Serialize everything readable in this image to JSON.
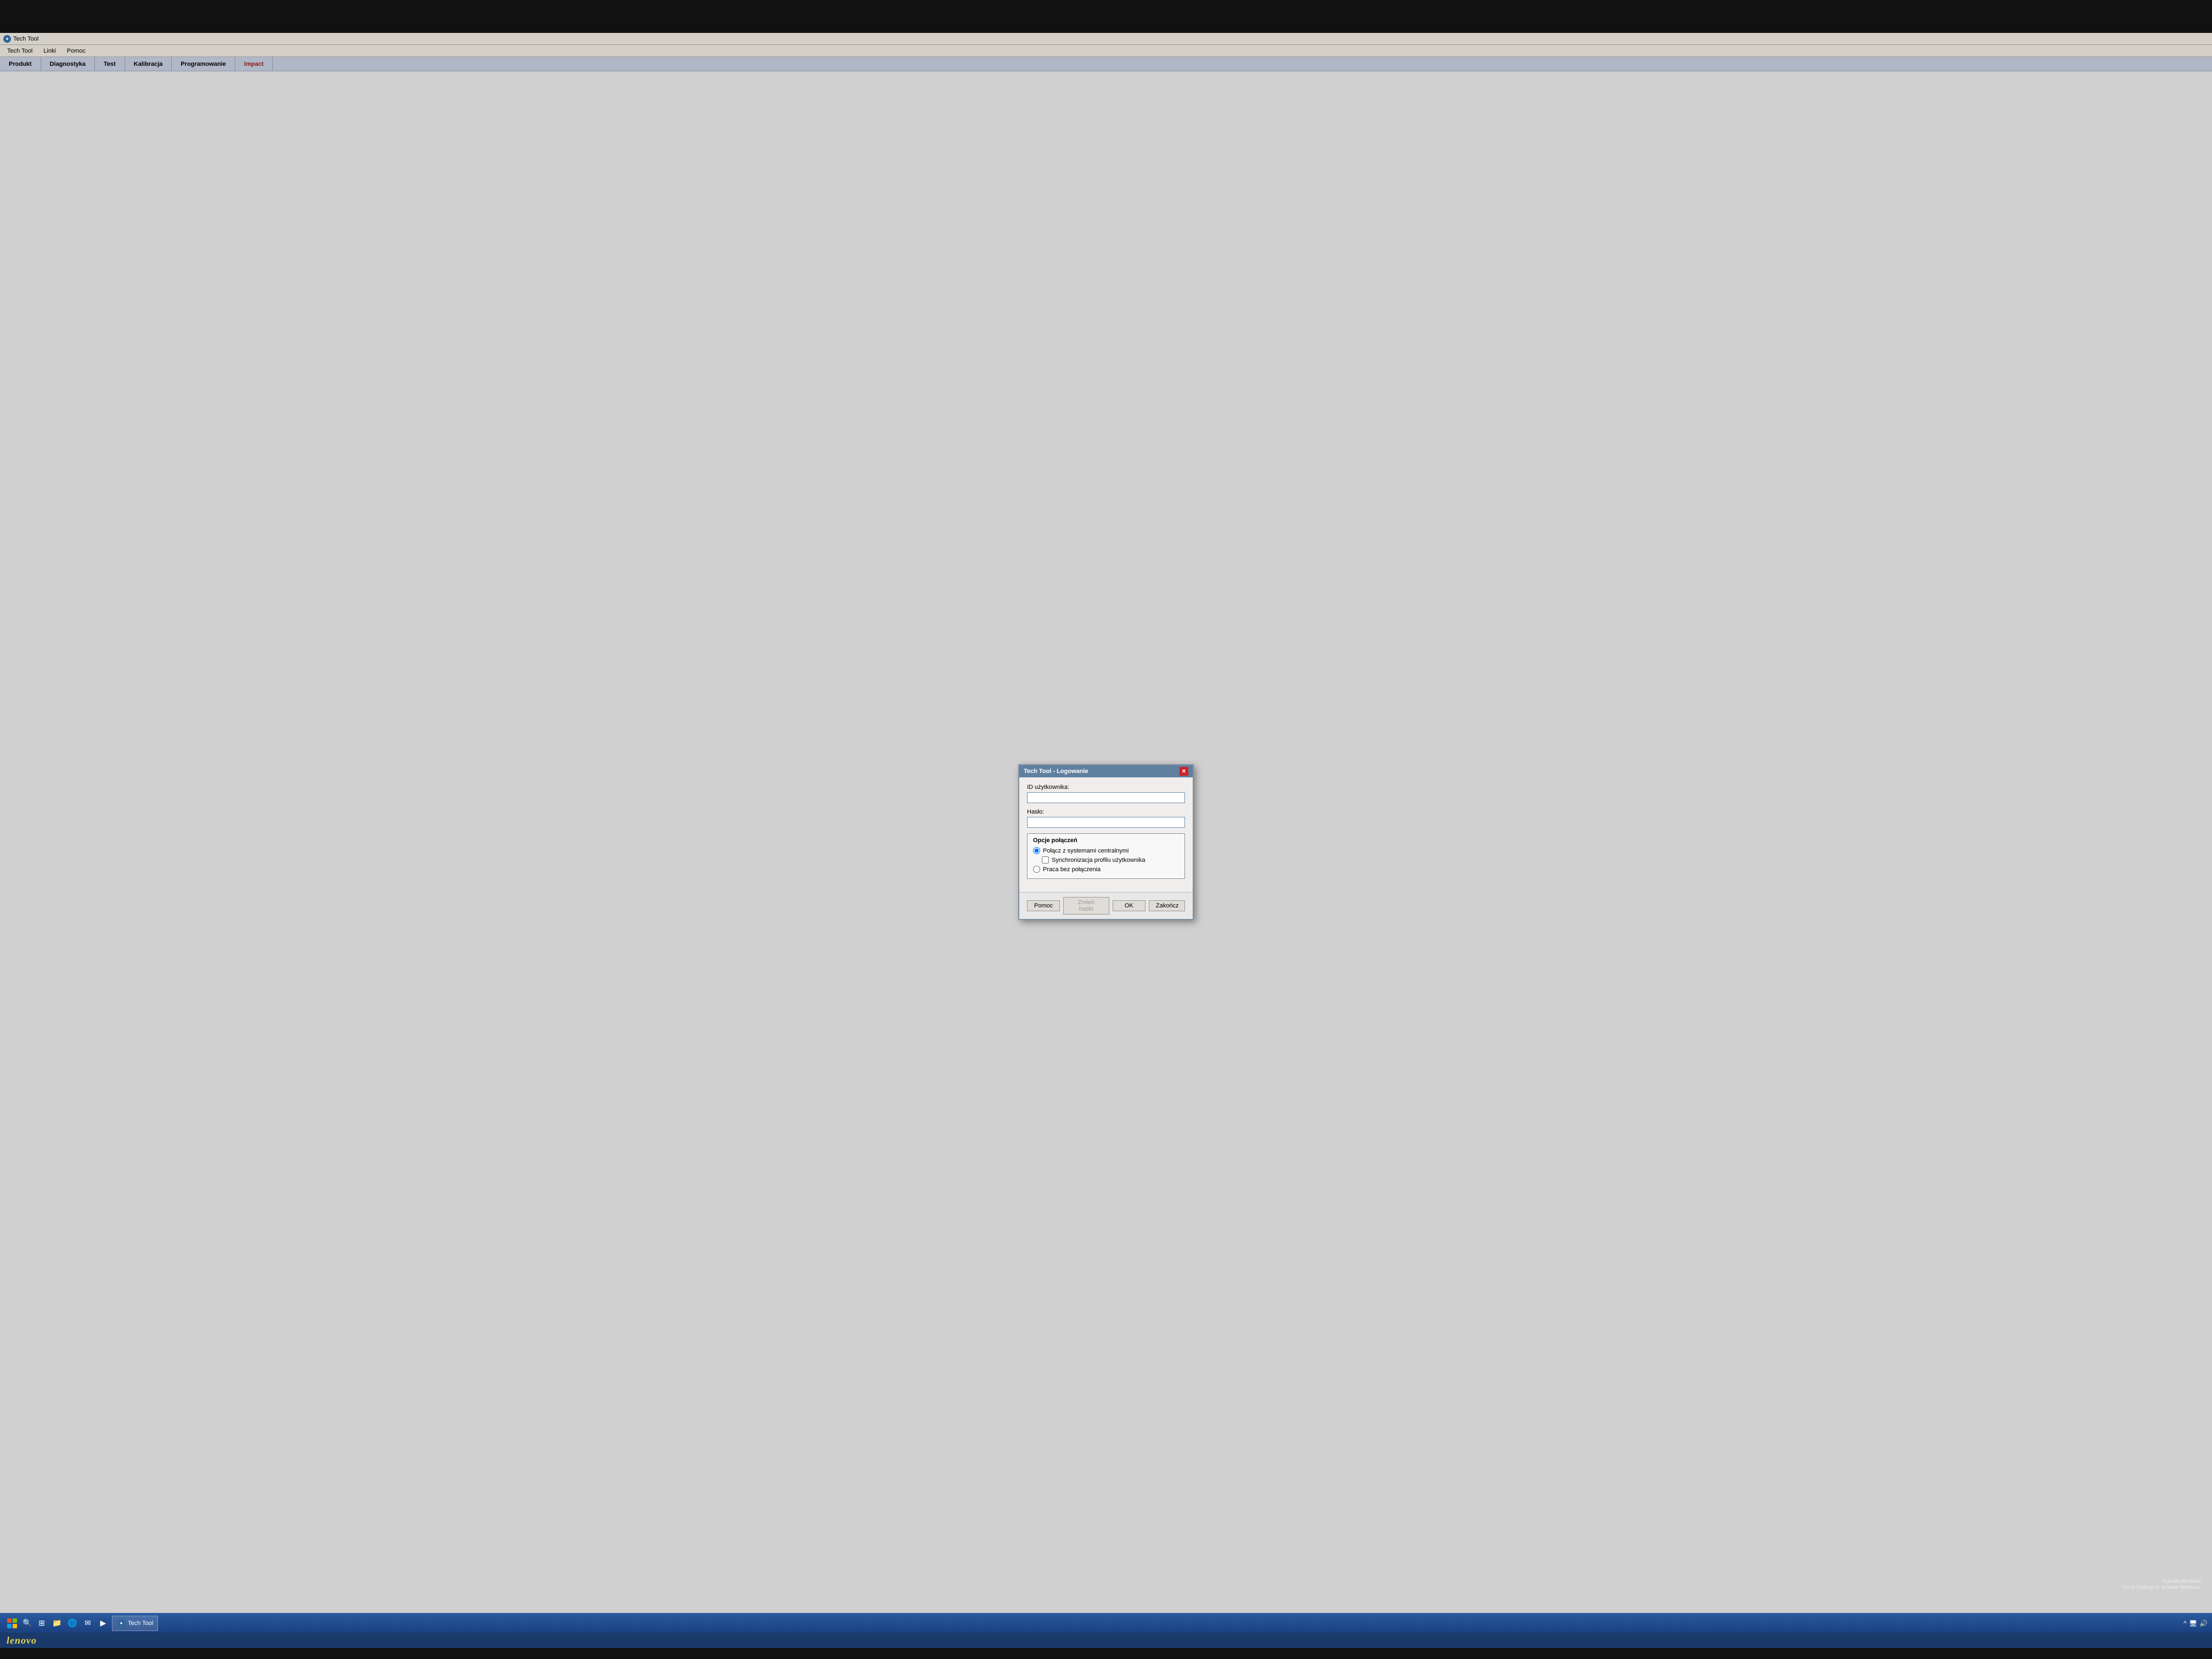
{
  "app": {
    "title": "Tech Tool",
    "title_icon_label": "TT"
  },
  "menu": {
    "items": [
      {
        "label": "Tech Tool",
        "id": "tech-tool"
      },
      {
        "label": "Linki",
        "id": "linki"
      },
      {
        "label": "Pomoc",
        "id": "pomoc"
      }
    ]
  },
  "nav": {
    "tabs": [
      {
        "label": "Produkt",
        "id": "produkt",
        "active": false
      },
      {
        "label": "Diagnostyka",
        "id": "diagnostyka",
        "active": false
      },
      {
        "label": "Test",
        "id": "test",
        "active": false
      },
      {
        "label": "Kalibracja",
        "id": "kalibracja",
        "active": false
      },
      {
        "label": "Programowanie",
        "id": "programowanie",
        "active": false
      },
      {
        "label": "Impact",
        "id": "impact",
        "active": true
      }
    ]
  },
  "dialog": {
    "title": "Tech Tool - Logowanie",
    "close_btn_label": "✕",
    "fields": {
      "user_id_label": "ID użytkownika:",
      "user_id_value": "",
      "password_label": "Hasło:",
      "password_value": ""
    },
    "connection_options": {
      "group_label": "Opcje połączeń",
      "options": [
        {
          "type": "radio",
          "label": "Połącz z systemami centralnymi",
          "name": "connection",
          "checked": true
        },
        {
          "type": "checkbox",
          "label": "Synchronizacja profilu użytkownika",
          "name": "sync_profile",
          "checked": false,
          "indent": true
        },
        {
          "type": "radio",
          "label": "Praca bez połączenia",
          "name": "connection",
          "checked": false
        }
      ]
    },
    "buttons": [
      {
        "label": "Pomoc",
        "id": "help-btn",
        "disabled": false
      },
      {
        "label": "Zmień hasło",
        "id": "change-password-btn",
        "disabled": true
      },
      {
        "label": "OK",
        "id": "ok-btn",
        "disabled": false
      },
      {
        "label": "Zakończ",
        "id": "exit-btn",
        "disabled": false
      }
    ]
  },
  "taskbar": {
    "app_label": "Tech Tool",
    "activate_windows_line1": "Activate Windows",
    "activate_windows_line2": "Go to Settings to activate Windows.",
    "lenovo_logo": "lenovo"
  }
}
